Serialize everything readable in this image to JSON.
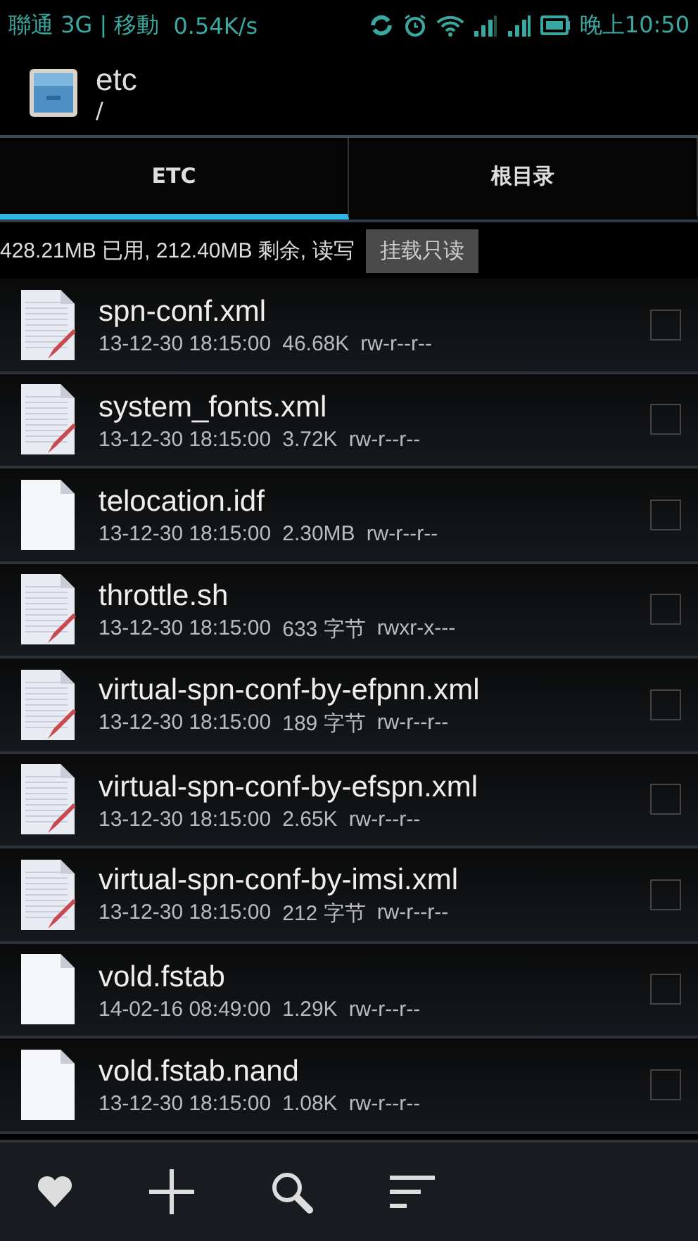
{
  "status_bar": {
    "carrier": "聯通 3G | 移動",
    "speed": "0.54K/s",
    "time": "晚上10:50"
  },
  "header": {
    "title": "etc",
    "path": "/"
  },
  "tabs": [
    {
      "label": "ETC",
      "selected": true
    },
    {
      "label": "根目录",
      "selected": false
    }
  ],
  "storage": {
    "summary": "428.21MB 已用, 212.40MB 剩余, 读写",
    "button": "挂载只读"
  },
  "files": [
    {
      "name": "spn-conf.xml",
      "date": "13-12-30 18:15:00",
      "size": "46.68K",
      "perms": "rw-r--r--",
      "kind": "text",
      "checked": false
    },
    {
      "name": "system_fonts.xml",
      "date": "13-12-30 18:15:00",
      "size": "3.72K",
      "perms": "rw-r--r--",
      "kind": "text",
      "checked": false
    },
    {
      "name": "telocation.idf",
      "date": "13-12-30 18:15:00",
      "size": "2.30MB",
      "perms": "rw-r--r--",
      "kind": "plain",
      "checked": false
    },
    {
      "name": "throttle.sh",
      "date": "13-12-30 18:15:00",
      "size": "633 字节",
      "perms": "rwxr-x---",
      "kind": "text",
      "checked": false
    },
    {
      "name": "virtual-spn-conf-by-efpnn.xml",
      "date": "13-12-30 18:15:00",
      "size": "189 字节",
      "perms": "rw-r--r--",
      "kind": "text",
      "checked": false
    },
    {
      "name": "virtual-spn-conf-by-efspn.xml",
      "date": "13-12-30 18:15:00",
      "size": "2.65K",
      "perms": "rw-r--r--",
      "kind": "text",
      "checked": false
    },
    {
      "name": "virtual-spn-conf-by-imsi.xml",
      "date": "13-12-30 18:15:00",
      "size": "212 字节",
      "perms": "rw-r--r--",
      "kind": "text",
      "checked": false
    },
    {
      "name": "vold.fstab",
      "date": "14-02-16 08:49:00",
      "size": "1.29K",
      "perms": "rw-r--r--",
      "kind": "plain",
      "checked": false
    },
    {
      "name": "vold.fstab.nand",
      "date": "13-12-30 18:15:00",
      "size": "1.08K",
      "perms": "rw-r--r--",
      "kind": "plain",
      "checked": false
    }
  ]
}
